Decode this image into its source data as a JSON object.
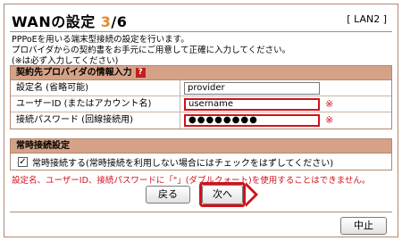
{
  "header": {
    "title_prefix": "WANの設定 ",
    "step_current": "3",
    "step_total": "/6",
    "interface_label": "[ LAN2 ]"
  },
  "intro": {
    "lines": [
      "PPPoEを用いる端末型接続の設定を行います。",
      "プロバイダからの契約書をお手元にご用意して正確に入力してください。",
      "(※は必ず入力してください)"
    ]
  },
  "provider_section": {
    "heading": "契約先プロバイダの情報入力",
    "help_icon_glyph": "?",
    "fields": [
      {
        "label": "設定名 (省略可能)",
        "value": "provider",
        "required_mark": ""
      },
      {
        "label": "ユーザーID (またはアカウント名)",
        "value": "username",
        "required_mark": "※"
      },
      {
        "label": "接続パスワード (回線接続用)",
        "value": "●●●●●●●●",
        "required_mark": "※"
      }
    ]
  },
  "always_on_section": {
    "heading": "常時接続設定",
    "checkbox_checked": true,
    "checkbox_glyph": "✓",
    "checkbox_label": "常時接続する(常時接続を利用しない場合にはチェックをはずしてください)"
  },
  "warning": "設定名、ユーザーID、接続パスワードに「\"」(ダブルクォート)を使用することはできません。",
  "buttons": {
    "back": "戻る",
    "next": "次へ",
    "cancel": "中止"
  },
  "colors": {
    "accent_step": "#e08a2c",
    "panel_header": "#d6a287",
    "highlight_red": "#d0121c",
    "border": "#b08a70"
  }
}
